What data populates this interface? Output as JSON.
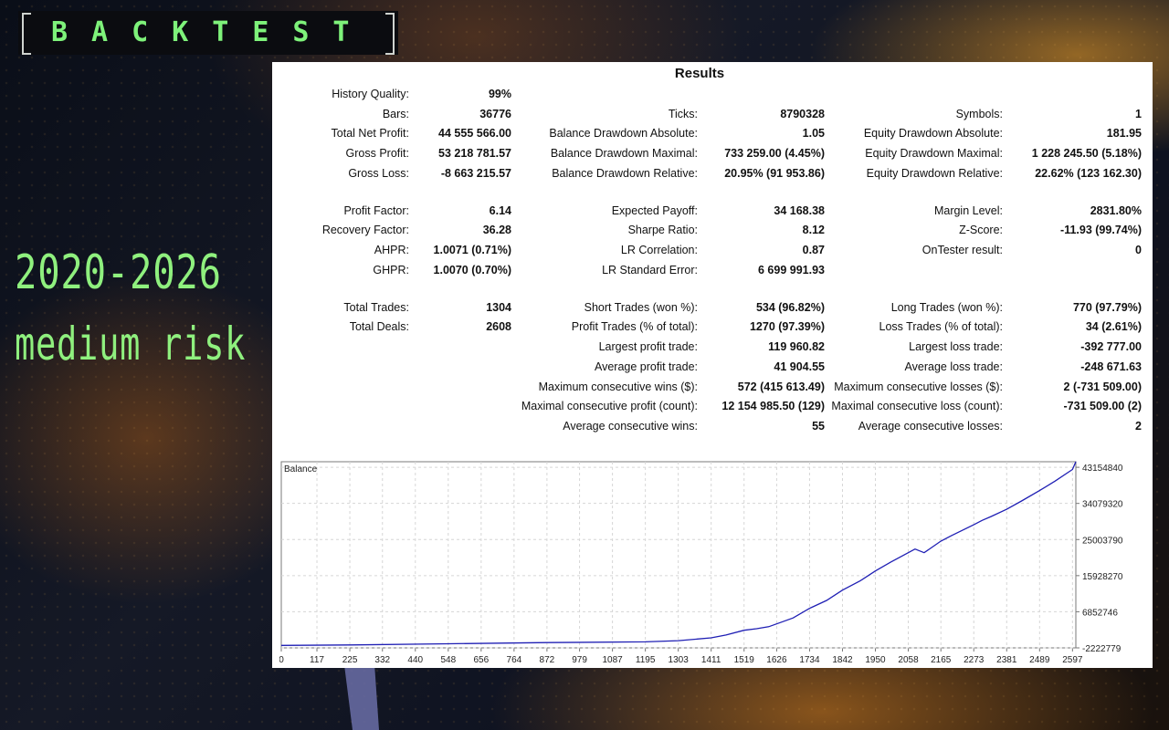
{
  "header": {
    "badge_text": "BACKTEST"
  },
  "side": {
    "years": "2020-2026",
    "risk": "medium risk"
  },
  "results": {
    "title": "Results",
    "rows": [
      {
        "y": 36,
        "cells": [
          {
            "label": "History Quality:",
            "value": "99%"
          }
        ]
      },
      {
        "y": 58,
        "cells": [
          {
            "label": "Bars:",
            "value": "36776"
          },
          {
            "label": "Ticks:",
            "value": "8790328"
          },
          {
            "label": "Symbols:",
            "value": "1"
          }
        ]
      },
      {
        "y": 79,
        "cells": [
          {
            "label": "Total Net Profit:",
            "value": "44 555 566.00"
          },
          {
            "label": "Balance Drawdown Absolute:",
            "value": "1.05"
          },
          {
            "label": "Equity Drawdown Absolute:",
            "value": "181.95"
          }
        ]
      },
      {
        "y": 101,
        "cells": [
          {
            "label": "Gross Profit:",
            "value": "53 218 781.57"
          },
          {
            "label": "Balance Drawdown Maximal:",
            "value": "733 259.00 (4.45%)"
          },
          {
            "label": "Equity Drawdown Maximal:",
            "value": "1 228 245.50 (5.18%)"
          }
        ]
      },
      {
        "y": 123,
        "cells": [
          {
            "label": "Gross Loss:",
            "value": "-8 663 215.57"
          },
          {
            "label": "Balance Drawdown Relative:",
            "value": "20.95% (91 953.86)"
          },
          {
            "label": "Equity Drawdown Relative:",
            "value": "22.62% (123 162.30)"
          }
        ]
      },
      {
        "y": 164,
        "cells": [
          {
            "label": "Profit Factor:",
            "value": "6.14"
          },
          {
            "label": "Expected Payoff:",
            "value": "34 168.38"
          },
          {
            "label": "Margin Level:",
            "value": "2831.80%"
          }
        ]
      },
      {
        "y": 185,
        "cells": [
          {
            "label": "Recovery Factor:",
            "value": "36.28"
          },
          {
            "label": "Sharpe Ratio:",
            "value": "8.12"
          },
          {
            "label": "Z-Score:",
            "value": "-11.93 (99.74%)"
          }
        ]
      },
      {
        "y": 207,
        "cells": [
          {
            "label": "AHPR:",
            "value": "1.0071 (0.71%)"
          },
          {
            "label": "LR Correlation:",
            "value": "0.87"
          },
          {
            "label": "OnTester result:",
            "value": "0"
          }
        ]
      },
      {
        "y": 229,
        "cells": [
          {
            "label": "GHPR:",
            "value": "1.0070 (0.70%)"
          },
          {
            "label": "LR Standard Error:",
            "value": "6 699 991.93"
          }
        ]
      },
      {
        "y": 270,
        "cells": [
          {
            "label": "Total Trades:",
            "value": "1304"
          },
          {
            "label": "Short Trades (won %):",
            "value": "534 (96.82%)"
          },
          {
            "label": "Long Trades (won %):",
            "value": "770 (97.79%)"
          }
        ]
      },
      {
        "y": 291,
        "cells": [
          {
            "label": "Total Deals:",
            "value": "2608"
          },
          {
            "label": "Profit Trades (% of total):",
            "value": "1270 (97.39%)"
          },
          {
            "label": "Loss Trades (% of total):",
            "value": "34 (2.61%)"
          }
        ]
      },
      {
        "y": 313,
        "cells": [
          null,
          {
            "label": "Largest profit trade:",
            "value": "119 960.82"
          },
          {
            "label": "Largest loss trade:",
            "value": "-392 777.00"
          }
        ]
      },
      {
        "y": 335,
        "cells": [
          null,
          {
            "label": "Average profit trade:",
            "value": "41 904.55"
          },
          {
            "label": "Average loss trade:",
            "value": "-248 671.63"
          }
        ]
      },
      {
        "y": 357,
        "cells": [
          null,
          {
            "label": "Maximum consecutive wins ($):",
            "value": "572 (415 613.49)"
          },
          {
            "label": "Maximum consecutive losses ($):",
            "value": "2 (-731 509.00)"
          }
        ]
      },
      {
        "y": 378,
        "cells": [
          null,
          {
            "label": "Maximal consecutive profit (count):",
            "value": "12 154 985.50 (129)"
          },
          {
            "label": "Maximal consecutive loss (count):",
            "value": "-731 509.00 (2)"
          }
        ]
      },
      {
        "y": 400,
        "cells": [
          null,
          {
            "label": "Average consecutive wins:",
            "value": "55"
          },
          {
            "label": "Average consecutive losses:",
            "value": "2"
          }
        ]
      }
    ]
  },
  "chart_data": {
    "type": "line",
    "title": "Balance",
    "x_ticks": [
      0,
      117,
      225,
      332,
      440,
      548,
      656,
      764,
      872,
      979,
      1087,
      1195,
      1303,
      1411,
      1519,
      1626,
      1734,
      1842,
      1950,
      2058,
      2165,
      2273,
      2381,
      2489,
      2597
    ],
    "y_tick_labels": [
      "43154840",
      "34079320",
      "25003790",
      "15928270",
      "6852746",
      "-2222779"
    ],
    "y_tick_values": [
      43154840,
      34079320,
      25003790,
      15928270,
      6852746,
      -2222779
    ],
    "xlim": [
      0,
      2608
    ],
    "ylim": [
      -2222779,
      44555566
    ],
    "grid": true,
    "series": [
      {
        "color": "#1f1fb4",
        "x": [
          0,
          225,
          548,
          872,
          1195,
          1303,
          1411,
          1460,
          1519,
          1560,
          1600,
          1626,
          1680,
          1734,
          1790,
          1842,
          1900,
          1950,
          2000,
          2058,
          2080,
          2110,
          2165,
          2200,
          2273,
          2300,
          2330,
          2381,
          2430,
          2489,
          2540,
          2597,
          2608
        ],
        "y": [
          -1600000,
          -1500000,
          -1200000,
          -900000,
          -700000,
          -400000,
          300000,
          1000000,
          2200000,
          2600000,
          3100000,
          3800000,
          5300000,
          7700000,
          9700000,
          12300000,
          14600000,
          17100000,
          19300000,
          21700000,
          22600000,
          21700000,
          24600000,
          26000000,
          28700000,
          29800000,
          30800000,
          32600000,
          34700000,
          37300000,
          39700000,
          42600000,
          44555566
        ]
      }
    ]
  }
}
